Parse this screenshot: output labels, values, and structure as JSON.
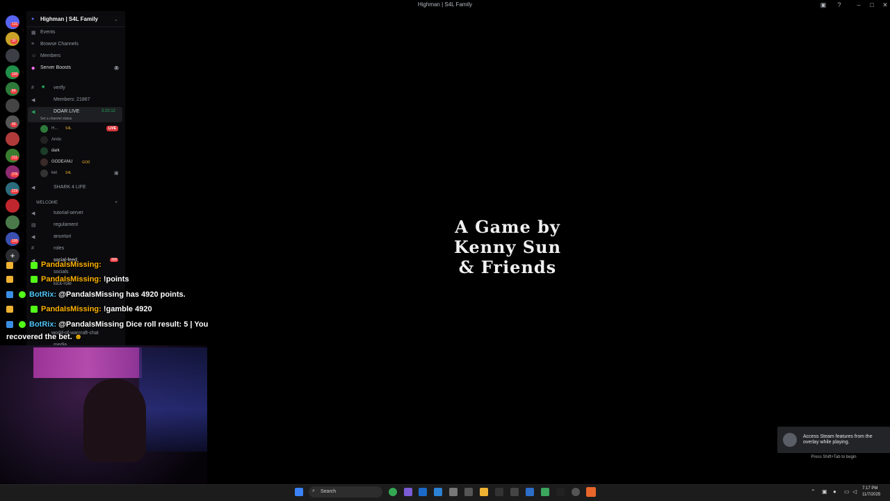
{
  "window": {
    "title": "Highman | S4L Family"
  },
  "server_rail": {
    "badges": [
      "131",
      "30",
      "100",
      "84",
      "40",
      "211",
      "270",
      "229",
      "100"
    ]
  },
  "sidebar": {
    "server_name": "Highman | S4L Family",
    "menu": [
      {
        "label": "Events",
        "icon": "calendar-icon"
      },
      {
        "label": "Browse Channels",
        "icon": "list-icon"
      },
      {
        "label": "Members",
        "icon": "members-icon"
      },
      {
        "label": "Server Boosts",
        "icon": "boost-icon",
        "count": "2"
      }
    ],
    "channels": {
      "verify": "verify",
      "members_count": "Members: 21867",
      "voice_live": "DOAR LIVE",
      "voice_live_timer": "3:20:12",
      "set_status": "Set a channel status",
      "live_badge": "LIVE",
      "voice_users": [
        "H...",
        "Andu",
        "dark",
        "GODEANU",
        "ket"
      ],
      "voice_user_tags": [
        "S4L",
        "",
        "",
        "GOD",
        "S4L"
      ],
      "shark": "SHARK 4 LIFE",
      "category": "WELCOME",
      "welcome": [
        "tutorial-server",
        "regulament",
        "anunturi",
        "roles",
        "social-feed",
        "socials",
        "kick-role"
      ],
      "social_feed_count": "300",
      "lower": [
        "world-of-warcraft-chat",
        "media"
      ]
    }
  },
  "chat": [
    {
      "user": "PandaIsMissing:",
      "text": "",
      "kind": "p"
    },
    {
      "user": "PandaIsMissing:",
      "text": "!points",
      "kind": "p"
    },
    {
      "user": "BotRix:",
      "text": "@PandaIsMissing has 4920 points.",
      "kind": "b"
    },
    {
      "user": "PandaIsMissing:",
      "text": "!gamble 4920",
      "kind": "p"
    },
    {
      "user": "BotRix:",
      "text": "@PandaIsMissing Dice roll result: 5 | You",
      "kind": "b"
    },
    {
      "user": "",
      "text": "recovered the bet.",
      "kind": "b"
    }
  ],
  "game": {
    "title_lines": [
      "A Game by",
      "Kenny Sun",
      "& Friends"
    ]
  },
  "steam_toast": {
    "text": "Access Steam features from the overlay while playing.",
    "hint": "Press Shift+Tab to begin"
  },
  "taskbar": {
    "search_label": "Search",
    "time": "7:17 PM",
    "date": "11/7/2025"
  },
  "colors": {
    "accent": "#5865f2",
    "live": "#da373c",
    "toast": "#232428"
  }
}
